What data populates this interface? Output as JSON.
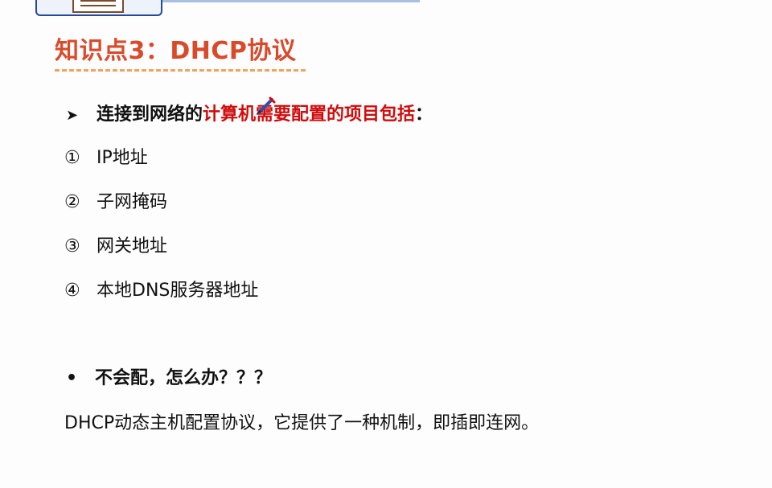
{
  "title": "知识点3：DHCP协议",
  "bullet": {
    "marker": "➤",
    "text_plain": "连接到网络的",
    "text_red": "计算机需要配置的项目包括",
    "text_end": "："
  },
  "items": [
    {
      "num": "①",
      "label": "IP地址"
    },
    {
      "num": "②",
      "label": "子网掩码"
    },
    {
      "num": "③",
      "label": "网关地址"
    },
    {
      "num": "④",
      "label": "本地DNS服务器地址"
    }
  ],
  "question": {
    "marker": "•",
    "text": "不会配，怎么办？？？"
  },
  "description": "DHCP动态主机配置协议，它提供了一种机制，即插即连网。",
  "colors": {
    "title": "#d94a2b",
    "highlight": "#d10a0a",
    "underline": "#f0a35a"
  },
  "icons": {
    "pen": "pen-icon",
    "document": "document-icon"
  }
}
